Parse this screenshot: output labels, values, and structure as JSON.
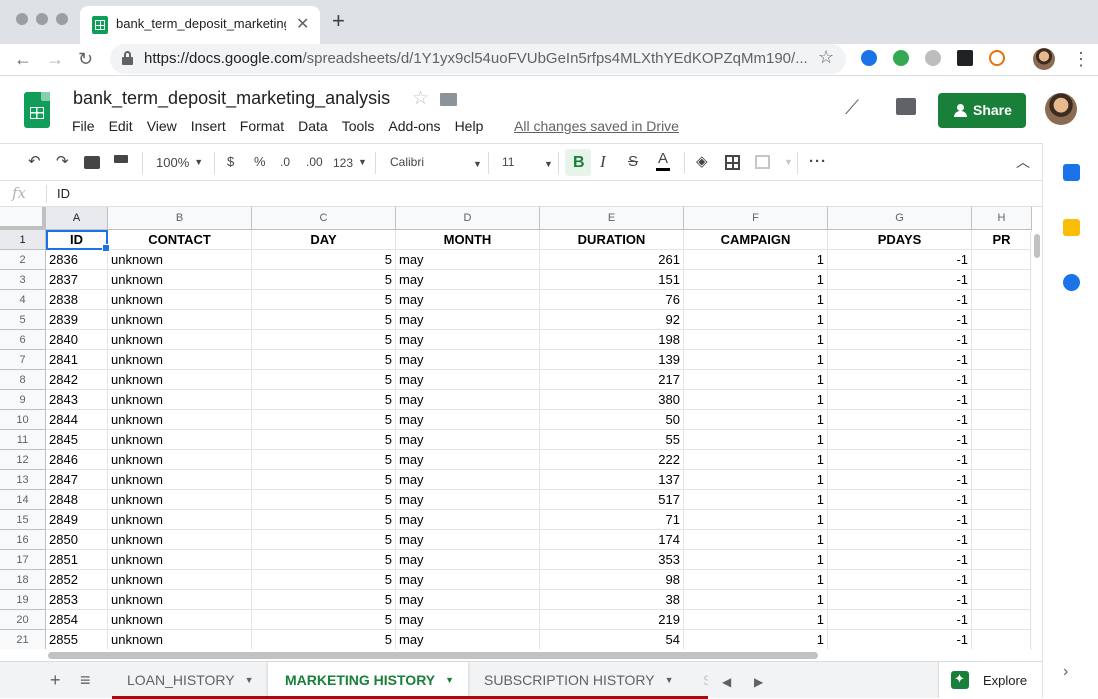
{
  "browser": {
    "tab_title": "bank_term_deposit_marketing_",
    "url_host": "https://docs.google.com",
    "url_path": "/spreadsheets/d/1Y1yx9cl54uoFVUbGeIn5rfps4MLXthYEdKOPZqMm190/..."
  },
  "app": {
    "doc_title": "bank_term_deposit_marketing_analysis",
    "menu": [
      "File",
      "Edit",
      "View",
      "Insert",
      "Format",
      "Data",
      "Tools",
      "Add-ons",
      "Help"
    ],
    "save_status": "All changes saved in Drive",
    "share_label": "Share"
  },
  "toolbar": {
    "zoom": "100%",
    "currency": "$",
    "percent": "%",
    "dec_decrease": ".0",
    "dec_increase": ".00",
    "more_formats": "123",
    "font": "Calibri",
    "font_size": "11",
    "bold": "B",
    "italic": "I",
    "strike": "S",
    "text_color": "A"
  },
  "formula_bar": {
    "fx": "fx",
    "value": "ID"
  },
  "grid": {
    "columns": [
      "A",
      "B",
      "C",
      "D",
      "E",
      "F",
      "G",
      "H"
    ],
    "row_numbers": [
      "1",
      "2",
      "3",
      "4",
      "5",
      "6",
      "7",
      "8",
      "9",
      "10",
      "11",
      "12",
      "13",
      "14",
      "15",
      "16",
      "17",
      "18",
      "19",
      "20",
      "21"
    ],
    "header": [
      "ID",
      "CONTACT",
      "DAY",
      "MONTH",
      "DURATION",
      "CAMPAIGN",
      "PDAYS",
      "PR"
    ],
    "rows": [
      [
        "2836",
        "unknown",
        "5",
        "may",
        "261",
        "1",
        "-1"
      ],
      [
        "2837",
        "unknown",
        "5",
        "may",
        "151",
        "1",
        "-1"
      ],
      [
        "2838",
        "unknown",
        "5",
        "may",
        "76",
        "1",
        "-1"
      ],
      [
        "2839",
        "unknown",
        "5",
        "may",
        "92",
        "1",
        "-1"
      ],
      [
        "2840",
        "unknown",
        "5",
        "may",
        "198",
        "1",
        "-1"
      ],
      [
        "2841",
        "unknown",
        "5",
        "may",
        "139",
        "1",
        "-1"
      ],
      [
        "2842",
        "unknown",
        "5",
        "may",
        "217",
        "1",
        "-1"
      ],
      [
        "2843",
        "unknown",
        "5",
        "may",
        "380",
        "1",
        "-1"
      ],
      [
        "2844",
        "unknown",
        "5",
        "may",
        "50",
        "1",
        "-1"
      ],
      [
        "2845",
        "unknown",
        "5",
        "may",
        "55",
        "1",
        "-1"
      ],
      [
        "2846",
        "unknown",
        "5",
        "may",
        "222",
        "1",
        "-1"
      ],
      [
        "2847",
        "unknown",
        "5",
        "may",
        "137",
        "1",
        "-1"
      ],
      [
        "2848",
        "unknown",
        "5",
        "may",
        "517",
        "1",
        "-1"
      ],
      [
        "2849",
        "unknown",
        "5",
        "may",
        "71",
        "1",
        "-1"
      ],
      [
        "2850",
        "unknown",
        "5",
        "may",
        "174",
        "1",
        "-1"
      ],
      [
        "2851",
        "unknown",
        "5",
        "may",
        "353",
        "1",
        "-1"
      ],
      [
        "2852",
        "unknown",
        "5",
        "may",
        "98",
        "1",
        "-1"
      ],
      [
        "2853",
        "unknown",
        "5",
        "may",
        "38",
        "1",
        "-1"
      ],
      [
        "2854",
        "unknown",
        "5",
        "may",
        "219",
        "1",
        "-1"
      ],
      [
        "2855",
        "unknown",
        "5",
        "may",
        "54",
        "1",
        "-1"
      ]
    ]
  },
  "sheets": {
    "tabs": [
      "LOAN_HISTORY",
      "MARKETING HISTORY",
      "SUBSCRIPTION HISTORY",
      "S"
    ],
    "active_index": 1,
    "explore_label": "Explore"
  },
  "colors": {
    "brand_green": "#188038",
    "selection_blue": "#1a73e8"
  }
}
